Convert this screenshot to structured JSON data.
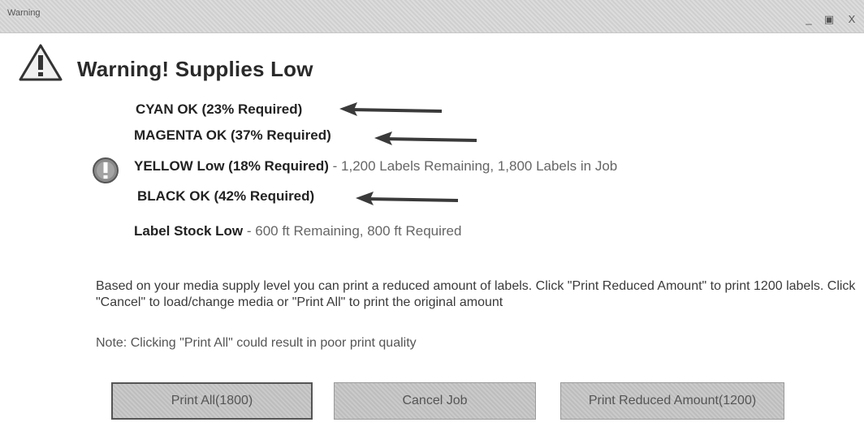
{
  "window": {
    "title": "Warning",
    "controls": {
      "minimize": "_",
      "maximize": "▣",
      "close": "X"
    }
  },
  "dialog": {
    "title": "Warning! Supplies Low",
    "icon": "warning-triangle-icon"
  },
  "supplies": {
    "cyan": {
      "bold": "CYAN OK (23% Required)",
      "detail": ""
    },
    "magenta": {
      "bold": "MAGENTA OK (37% Required)",
      "detail": ""
    },
    "yellow": {
      "bold": "YELLOW Low (18% Required)",
      "detail": " - 1,200 Labels Remaining, 1,800 Labels in Job",
      "icon": "exclamation-circle-icon"
    },
    "black": {
      "bold": "BLACK OK (42% Required)",
      "detail": ""
    },
    "label_stock": {
      "bold": "Label Stock Low",
      "detail": " - 600 ft Remaining, 800 ft Required"
    }
  },
  "message": {
    "body": "Based on your media supply level you can print a reduced amount of labels. Click \"Print Reduced Amount\" to print 1200 labels. Click \"Cancel\" to load/change media or \"Print All\" to print the original amount",
    "note": "Note: Clicking \"Print All\" could result in poor print quality"
  },
  "buttons": {
    "print_all": "Print All(1800)",
    "cancel": "Cancel Job",
    "print_reduced": "Print Reduced Amount(1200)"
  },
  "colors": {
    "arrow": "#3a3a3a",
    "button_bg": "#c4c4c4"
  }
}
